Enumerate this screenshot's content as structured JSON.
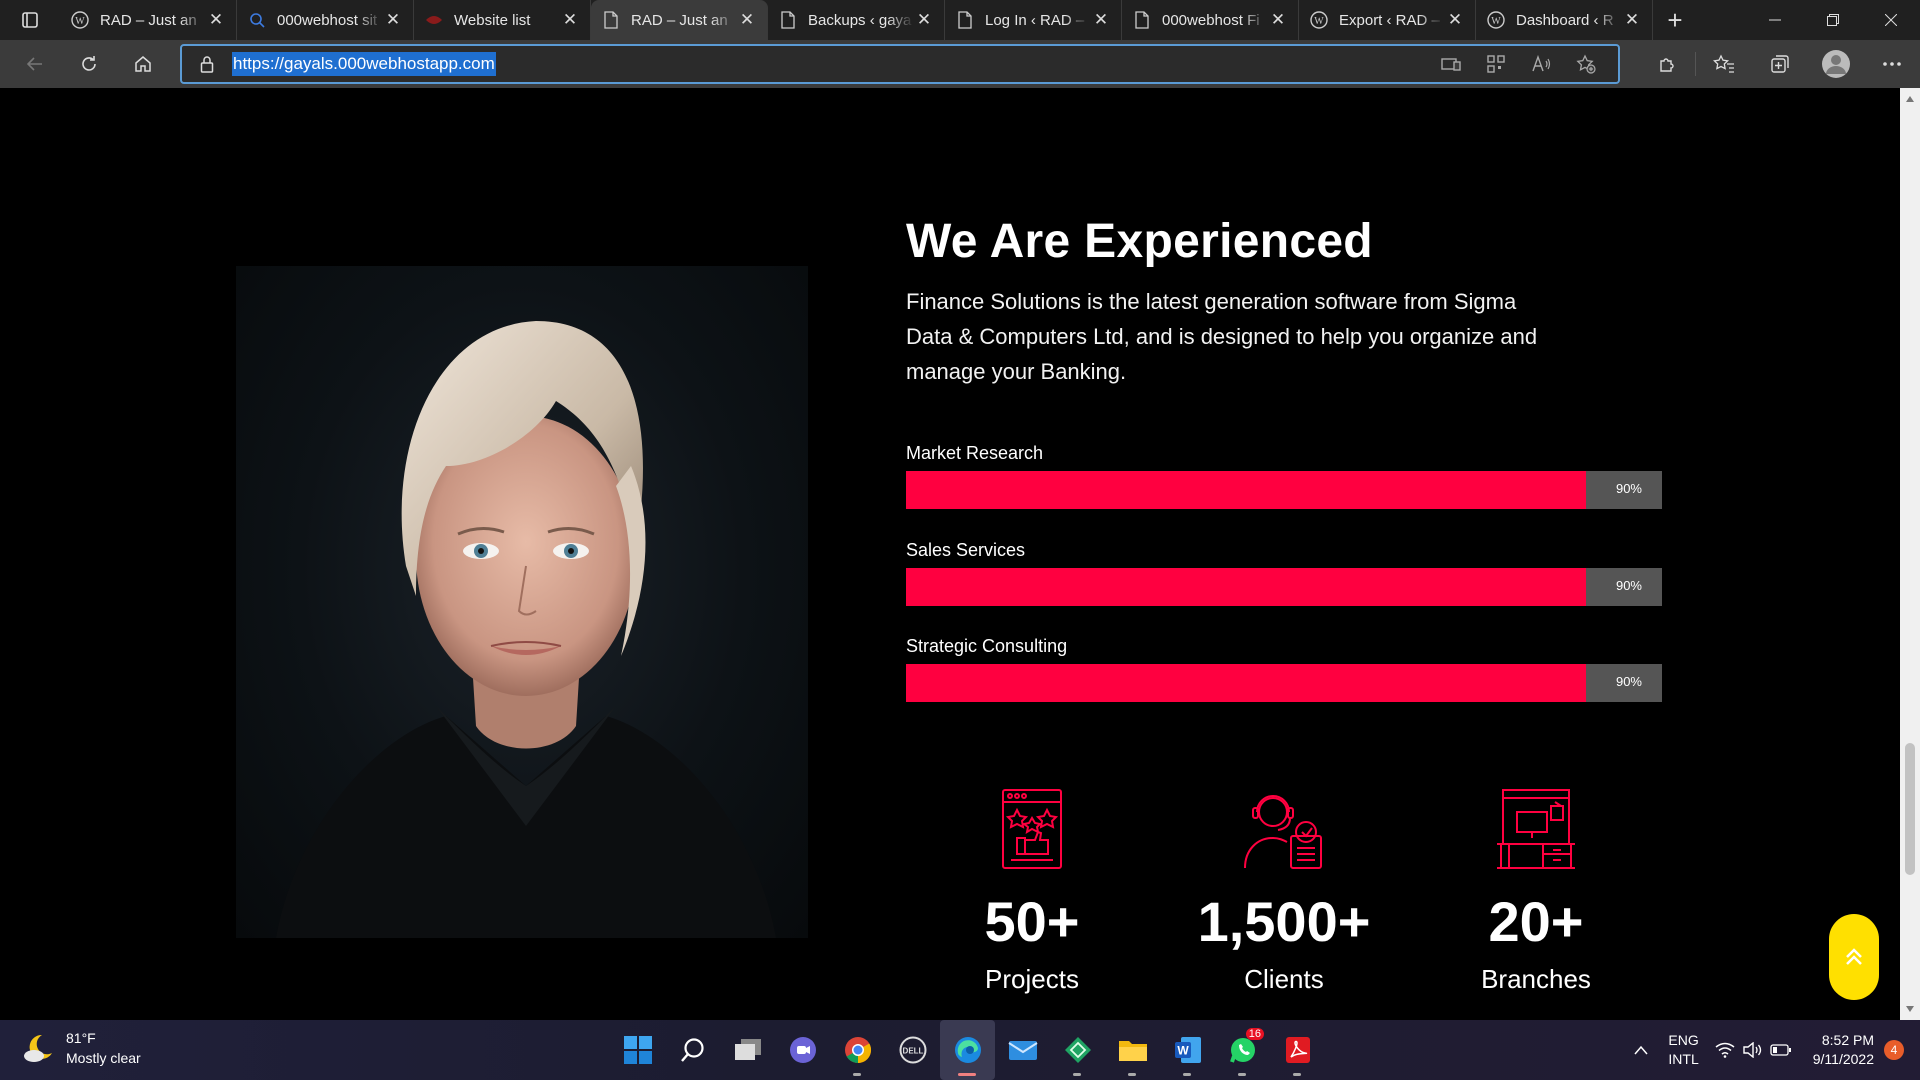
{
  "browser": {
    "tabs": [
      {
        "label": "RAD – Just an",
        "icon": "wordpress-icon",
        "active": false
      },
      {
        "label": "000webhost sit",
        "icon": "search-icon",
        "active": false
      },
      {
        "label": "Website list",
        "icon": "webhost-icon",
        "active": false
      },
      {
        "label": "RAD – Just an",
        "icon": "page-icon",
        "active": true
      },
      {
        "label": "Backups ‹ gaya",
        "icon": "page-icon",
        "active": false
      },
      {
        "label": "Log In ‹ RAD –",
        "icon": "page-icon",
        "active": false
      },
      {
        "label": "000webhost Fi",
        "icon": "page-icon",
        "active": false
      },
      {
        "label": "Export ‹ RAD –",
        "icon": "wordpress-icon",
        "active": false
      },
      {
        "label": "Dashboard ‹ R",
        "icon": "wordpress-icon",
        "active": false
      }
    ],
    "url": "https://gayals.000webhostapp.com"
  },
  "page": {
    "heading": "We Are Experienced",
    "description": "Finance Solutions is the latest generation software from Sigma Data & Computers Ltd, and is designed to help you organize and manage your Banking.",
    "skills": [
      {
        "label": "Market Research",
        "percent_text": "90%",
        "fill_fraction": 0.9
      },
      {
        "label": "Sales Services",
        "percent_text": "90%",
        "fill_fraction": 0.9
      },
      {
        "label": "Strategic Consulting",
        "percent_text": "90%",
        "fill_fraction": 0.9
      }
    ],
    "stats": [
      {
        "number": "50+",
        "label": "Projects",
        "icon": "projects-icon"
      },
      {
        "number": "1,500+",
        "label": "Clients",
        "icon": "clients-icon"
      },
      {
        "number": "20+",
        "label": "Branches",
        "icon": "branches-icon"
      }
    ],
    "colors": {
      "accent": "#ff0040",
      "bar_track": "#555555",
      "back_to_top": "#ffe000"
    }
  },
  "taskbar": {
    "weather": {
      "temp": "81°F",
      "condition": "Mostly clear"
    },
    "apps": [
      "start",
      "search",
      "task-view",
      "teams",
      "chrome",
      "dell",
      "edge",
      "mail",
      "app",
      "file-explorer",
      "word",
      "whatsapp",
      "acrobat"
    ],
    "whatsapp_badge": "16",
    "lang_line1": "ENG",
    "lang_line2": "INTL",
    "time": "8:52 PM",
    "date": "9/11/2022",
    "notifications": "4"
  }
}
